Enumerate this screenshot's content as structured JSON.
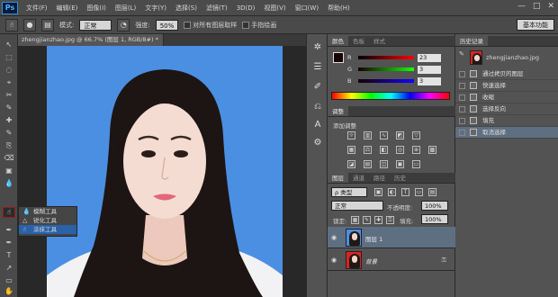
{
  "menu": {
    "logo": "Ps",
    "items": [
      "文件(F)",
      "编辑(E)",
      "图像(I)",
      "图层(L)",
      "文字(Y)",
      "选择(S)",
      "滤镜(T)",
      "3D(D)",
      "视图(V)",
      "窗口(W)",
      "帮助(H)"
    ],
    "window_controls": [
      "—",
      "□",
      "✕"
    ]
  },
  "options": {
    "mode_label": "模式:",
    "mode_value": "正常",
    "strength_label": "强度:",
    "strength_value": "50%",
    "sample_all_label": "对所有图层取样",
    "finger_paint_label": "手指绘画",
    "workspace": "基本功能"
  },
  "document": {
    "tab_title": "zhengjianzhao.jpg @ 66.7% (图层 1, RGB/8#) *",
    "tab_close": "×"
  },
  "tools": [
    "↖",
    "⬚",
    "◌",
    "⌖",
    "✂",
    "✎",
    "✚",
    "✎",
    "⎘",
    "⌫",
    "▣",
    "💧",
    "☝",
    "✒",
    "T",
    "↗",
    "▭",
    "✋"
  ],
  "flyout": {
    "items": [
      "模糊工具",
      "锐化工具",
      "涂抹工具"
    ],
    "icons": [
      "💧",
      "△",
      "☝"
    ],
    "selected": 2
  },
  "color_panel": {
    "tabs": [
      "颜色",
      "色板",
      "样式"
    ],
    "channels": [
      {
        "label": "R",
        "value": "23",
        "color": "#d40000"
      },
      {
        "label": "G",
        "value": "3",
        "color": "#00a000"
      },
      {
        "label": "B",
        "value": "3",
        "color": "#0030d0"
      }
    ]
  },
  "adjustments": {
    "tabs": [
      "调整"
    ],
    "add_label": "添加调整"
  },
  "layers": {
    "tabs": [
      "图层",
      "通道",
      "路径",
      "历史"
    ],
    "kind_label": "ρ 类型",
    "blend_mode": "正常",
    "opacity_label": "不透明度:",
    "opacity_value": "100%",
    "lock_label": "锁定:",
    "fill_label": "填充:",
    "fill_value": "100%",
    "rows": [
      {
        "name": "图层 1",
        "selected": true
      },
      {
        "name": "背景",
        "selected": false
      }
    ]
  },
  "history": {
    "tab": "历史记录",
    "snapshot": "zhengjianzhao.jpg",
    "items": [
      "通过拷贝的图层",
      "快速选择",
      "收缩",
      "选择反向",
      "填充",
      "取消选择"
    ],
    "selected_index": 5
  }
}
